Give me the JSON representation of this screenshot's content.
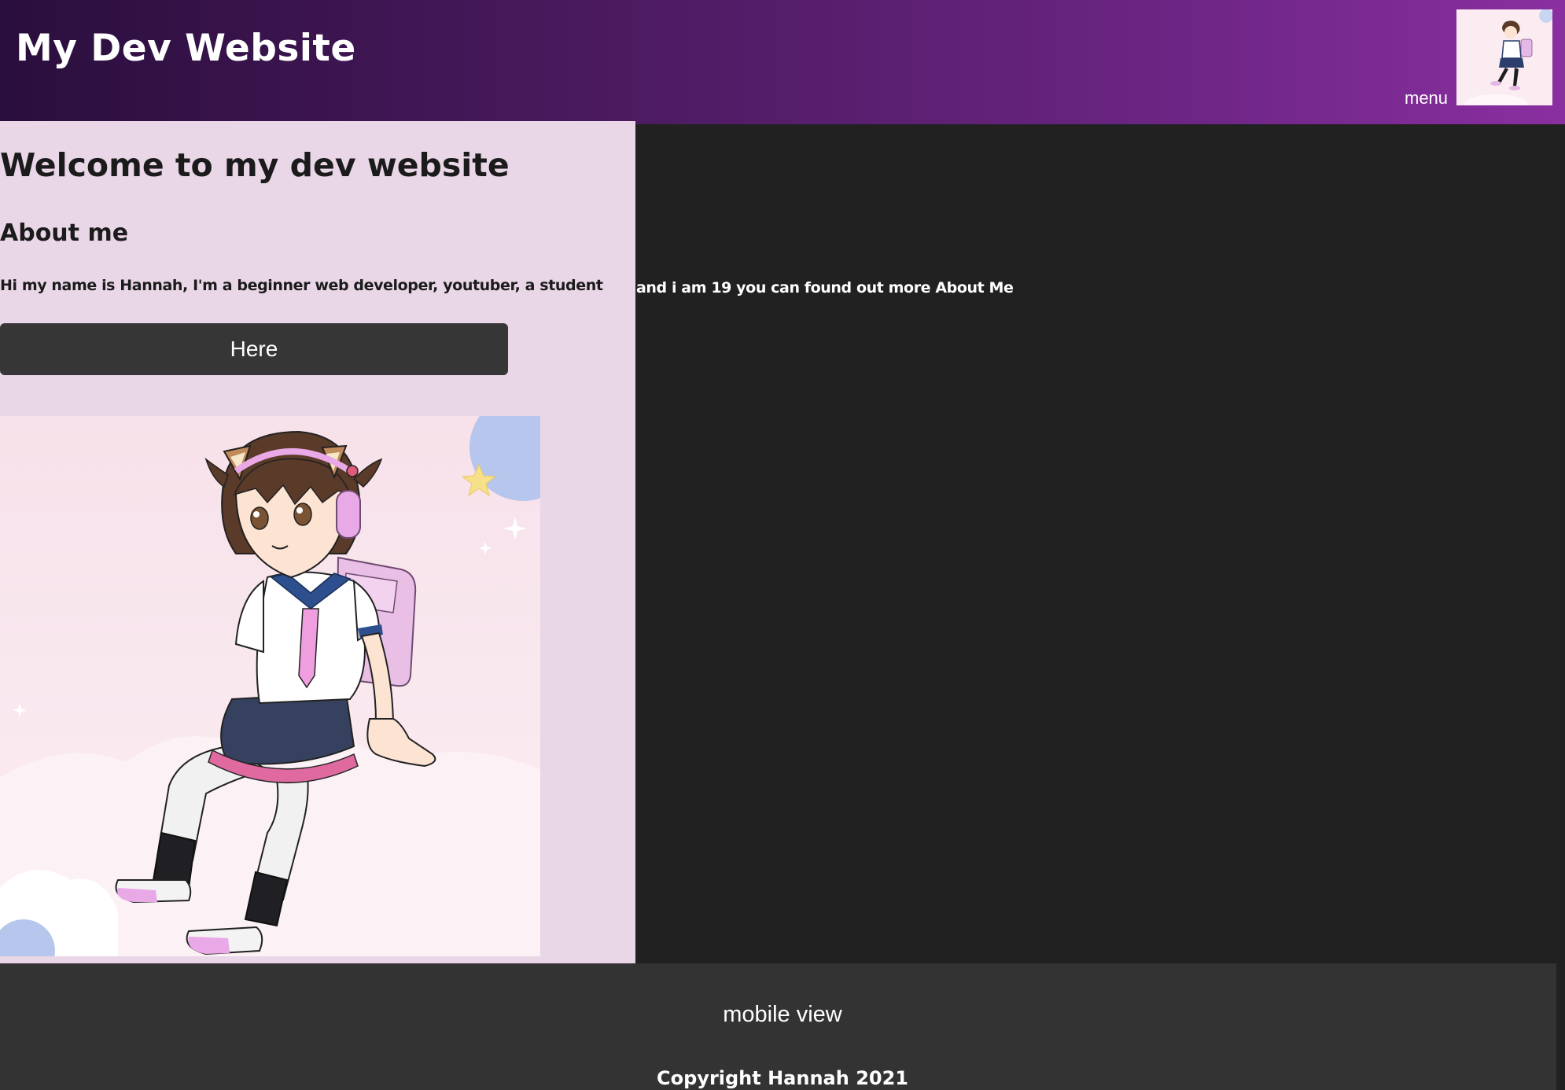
{
  "header": {
    "title": "My Dev Website",
    "menu_label": "menu",
    "avatar_icon": "anime-girl-avatar-icon"
  },
  "main": {
    "heading": "Welcome to my dev website",
    "subheading": "About me",
    "intro_part1": "Hi my name is Hannah, I'm a beginner web developer, youtuber, a student",
    "intro_part2": "and i am 19 you can found out more About Me",
    "here_button": "Here",
    "illustration_icon": "anime-girl-illustration"
  },
  "footer": {
    "view_link": "mobile view",
    "copyright": "Copyright Hannah 2021"
  },
  "colors": {
    "header_start": "#2a0e3d",
    "header_end": "#8a2fa0",
    "panel": "#e9d6e6",
    "page_background": "#212121",
    "button": "#363636",
    "footer": "#333333"
  }
}
